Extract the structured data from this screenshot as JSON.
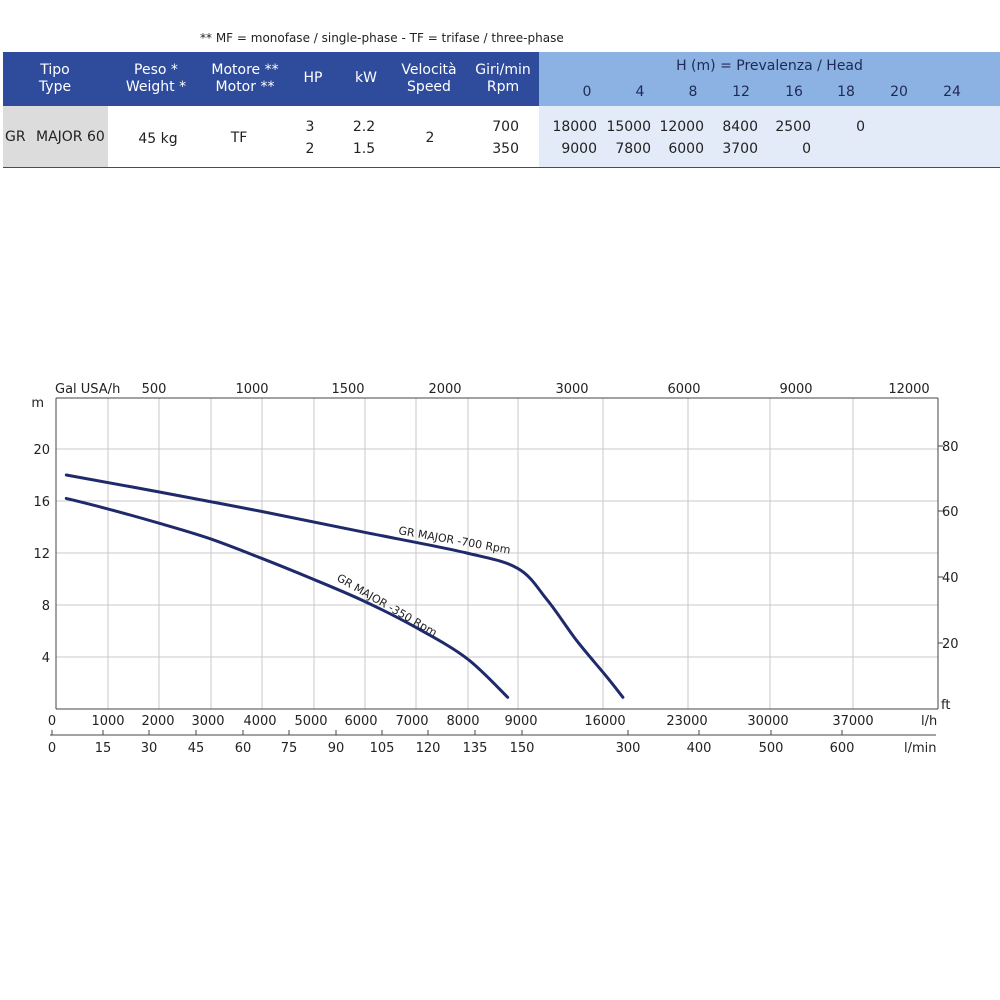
{
  "note": "** MF = monofase / single-phase - TF = trifase / three-phase",
  "table": {
    "headers": {
      "tipo": [
        "Tipo",
        "Type"
      ],
      "peso": [
        "Peso *",
        "Weight *"
      ],
      "motore": [
        "Motore **",
        "Motor **"
      ],
      "hp": "HP",
      "kw": "kW",
      "velocita": [
        "Velocità",
        "Speed"
      ],
      "giri": [
        "Giri/min",
        "Rpm"
      ],
      "head_title": "H (m) = Prevalenza / Head",
      "head_values": [
        "0",
        "4",
        "8",
        "12",
        "16",
        "18",
        "20",
        "24"
      ]
    },
    "row": {
      "series": "GR",
      "model": "MAJOR 60",
      "weight": "45 kg",
      "motor": "TF",
      "hp": [
        "3",
        "2"
      ],
      "kw": [
        "2.2",
        "1.5"
      ],
      "speed": "2",
      "rpm": [
        "700",
        "350"
      ],
      "flows": [
        [
          "18000",
          "15000",
          "12000",
          "8400",
          "2500",
          "0",
          "",
          ""
        ],
        [
          "9000",
          "7800",
          "6000",
          "3700",
          "0",
          "",
          "",
          ""
        ]
      ]
    }
  },
  "chart_data": {
    "type": "line",
    "left_axis": {
      "unit": "m",
      "ticks": [
        "4",
        "8",
        "12",
        "16",
        "20"
      ]
    },
    "right_axis": {
      "unit": "ft",
      "ticks": [
        "20",
        "40",
        "60",
        "80"
      ]
    },
    "top_axis": {
      "unit": "Gal USA/h",
      "ticks": [
        "500",
        "1000",
        "1500",
        "2000",
        "3000",
        "6000",
        "9000",
        "12000"
      ]
    },
    "bottom_axis_lh": {
      "unit": "l/h",
      "ticks": [
        "0",
        "1000",
        "2000",
        "3000",
        "4000",
        "5000",
        "6000",
        "7000",
        "8000",
        "9000",
        "16000",
        "23000",
        "30000",
        "37000"
      ]
    },
    "bottom_axis_lmin": {
      "unit": "l/min",
      "ticks": [
        "0",
        "15",
        "30",
        "45",
        "60",
        "75",
        "90",
        "105",
        "120",
        "135",
        "150",
        "300",
        "400",
        "500",
        "600"
      ]
    },
    "grid": true,
    "series": [
      {
        "name": "GR MAJOR -700 Rpm",
        "x_lh": [
          200,
          2000,
          4000,
          6000,
          8000,
          9000,
          11000,
          13000,
          15000,
          16300
        ],
        "y_m": [
          18.0,
          16.7,
          15.2,
          13.6,
          12.0,
          10.8,
          8.4,
          5.3,
          2.6,
          0.9
        ]
      },
      {
        "name": "GR MAJOR -350 Rpm",
        "x_lh": [
          200,
          1000,
          2000,
          3000,
          4000,
          5000,
          6000,
          7000,
          8000,
          8800
        ],
        "y_m": [
          16.2,
          15.4,
          14.3,
          13.1,
          11.6,
          10.0,
          8.3,
          6.3,
          3.9,
          0.9
        ]
      }
    ]
  },
  "colors": {
    "header_dark": "#2f4b9c",
    "header_light": "#8cb2e4",
    "curve": "#1f2a6b",
    "grid": "#c8c8c8"
  }
}
